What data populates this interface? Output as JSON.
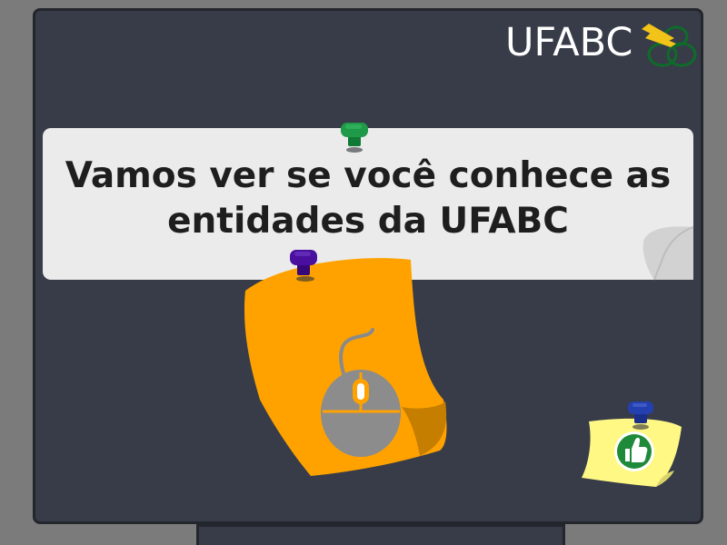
{
  "header": {
    "logo_text": "UFABC",
    "logo_icon": "ufabc-logo-icon"
  },
  "banner": {
    "title_line1": "Vamos ver se você conhece as",
    "title_line2": "entidades  da UFABC"
  },
  "icons": {
    "mouse": "mouse-icon",
    "thumbs_up": "thumbs-up-icon",
    "pins": [
      "green-pin-icon",
      "purple-pin-icon",
      "blue-pin-icon"
    ]
  },
  "colors": {
    "board": "#373c48",
    "banner": "#ebebeb",
    "orange_note": "#ffa200",
    "yellow_note": "#fff884",
    "thumbs_green": "#1f8a3a"
  }
}
